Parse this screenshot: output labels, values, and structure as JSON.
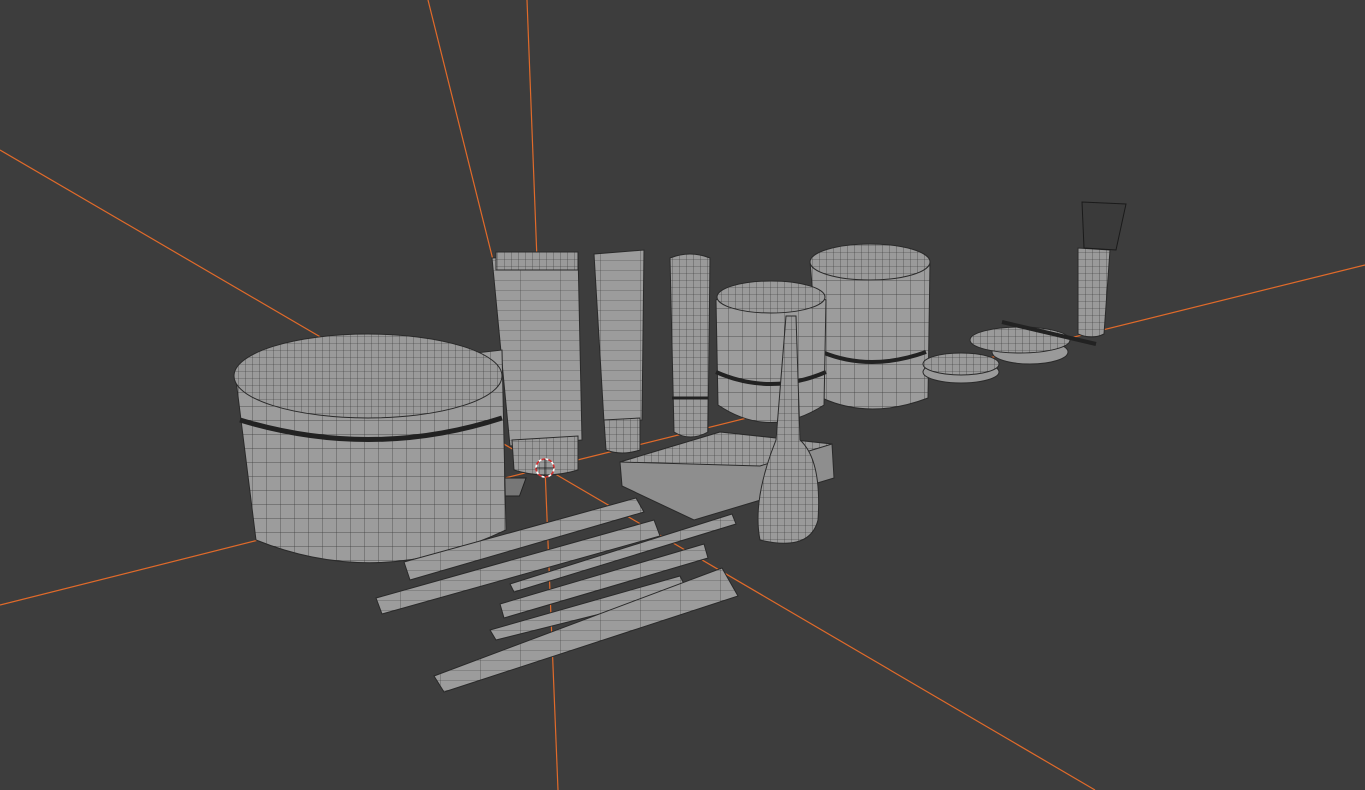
{
  "viewport": {
    "header_text": "",
    "background_color": "#3d3d3d",
    "radial_line_color": "#e06a2a",
    "mesh_fill_color": "#9a9a9a",
    "mesh_wire_color": "#2a2a2a"
  },
  "objects": [
    {
      "name": "cream-jar-large",
      "icon": "cylinder-jar-icon"
    },
    {
      "name": "squeeze-tube-large",
      "icon": "tube-icon"
    },
    {
      "name": "squeeze-tube-medium",
      "icon": "tube-icon"
    },
    {
      "name": "lip-tube-small",
      "icon": "stick-icon"
    },
    {
      "name": "round-jar-medium",
      "icon": "jar-icon"
    },
    {
      "name": "round-jar-tall",
      "icon": "jar-icon"
    },
    {
      "name": "eyeshadow-palette",
      "icon": "palette-icon"
    },
    {
      "name": "nail-polish-bottle",
      "icon": "bottle-icon"
    },
    {
      "name": "compact-powder-1",
      "icon": "compact-icon"
    },
    {
      "name": "compact-powder-2",
      "icon": "compact-icon"
    },
    {
      "name": "makeup-brush",
      "icon": "brush-icon"
    },
    {
      "name": "eyeliner-pencils",
      "icon": "pencil-icon"
    },
    {
      "name": "3d-cursor",
      "icon": "cursor-icon"
    }
  ]
}
